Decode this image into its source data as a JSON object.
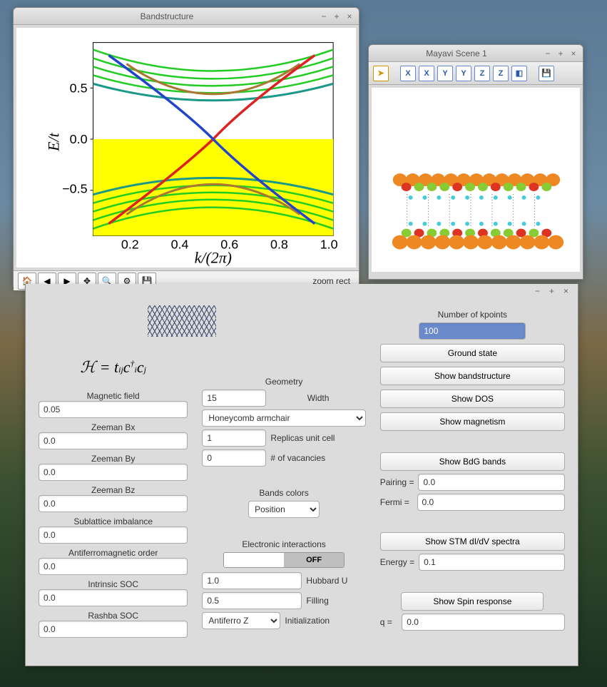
{
  "bandstructure_window": {
    "title": "Bandstructure",
    "ylabel": "E/t",
    "xlabel": "k/(2π)",
    "status": "zoom rect",
    "yticks": [
      "0.5",
      "0.0",
      "−0.5"
    ],
    "xticks": [
      "0.2",
      "0.4",
      "0.6",
      "0.8",
      "1.0"
    ]
  },
  "mayavi_window": {
    "title": "Mayavi Scene 1",
    "axis_buttons": [
      "X",
      "X",
      "Y",
      "Y",
      "Z",
      "Z"
    ]
  },
  "controls": {
    "hamiltonian": "ℋ = t𝑖𝑗 c†𝑖 c𝑗",
    "col1": {
      "magnetic_field_label": "Magnetic field",
      "magnetic_field": "0.05",
      "zeeman_bx_label": "Zeeman Bx",
      "zeeman_bx": "0.0",
      "zeeman_by_label": "Zeeman By",
      "zeeman_by": "0.0",
      "zeeman_bz_label": "Zeeman Bz",
      "zeeman_bz": "0.0",
      "sublattice_label": "Sublattice imbalance",
      "sublattice": "0.0",
      "afm_label": "Antiferromagnetic order",
      "afm": "0.0",
      "intrinsic_soc_label": "Intrinsic SOC",
      "intrinsic_soc": "0.0",
      "rashba_soc_label": "Rashba SOC",
      "rashba_soc": "0.0"
    },
    "col2": {
      "geometry_label": "Geometry",
      "width": "15",
      "width_label": "Width",
      "lattice": "Honeycomb armchair",
      "replicas": "1",
      "replicas_label": "Replicas unit cell",
      "vacancies": "0",
      "vacancies_label": "# of vacancies",
      "bands_colors_label": "Bands colors",
      "bands_colors": "Position",
      "eint_label": "Electronic interactions",
      "eint_toggle": "OFF",
      "hubbard": "1.0",
      "hubbard_label": "Hubbard U",
      "filling": "0.5",
      "filling_label": "Filling",
      "init": "Antiferro Z",
      "init_label": "Initialization"
    },
    "col3": {
      "kpoints_label": "Number of kpoints",
      "kpoints": "100",
      "ground_state": "Ground state",
      "show_bands": "Show bandstructure",
      "show_dos": "Show DOS",
      "show_mag": "Show magnetism",
      "show_bdg": "Show BdG bands",
      "pairing_label": "Pairing =",
      "pairing": "0.0",
      "fermi_label": "Fermi =",
      "fermi": "0.0",
      "show_stm": "Show STM dI/dV spectra",
      "energy_label": "Energy =",
      "energy": "0.1",
      "show_spin": "Show Spin response",
      "q_label": "q =",
      "q": "0.0"
    }
  },
  "chart_data": {
    "type": "line",
    "title": "Bandstructure",
    "xlabel": "k/(2π)",
    "ylabel": "E/t",
    "xlim": [
      0.05,
      1.0
    ],
    "ylim": [
      -0.9,
      0.9
    ],
    "description": "Multi-band electronic band structure of a honeycomb armchair ribbon. Dense green bulk bands occupy |E/t|>0.45; yellow shaded region marks occupied states E/t<0. Two in-gap edge/surface bands dispersing roughly linearly through the gap, colored red (left-origin) and blue (right-origin), cross near k≈0.5, E≈0.",
    "series": [
      {
        "name": "edge-band-red",
        "color": "#dd2222",
        "x": [
          0.05,
          0.15,
          0.25,
          0.35,
          0.45,
          0.5,
          0.55,
          0.65,
          0.75,
          0.85,
          0.95
        ],
        "y": [
          -0.8,
          -0.72,
          -0.55,
          -0.3,
          -0.08,
          0.0,
          0.1,
          0.35,
          0.55,
          0.7,
          0.78
        ]
      },
      {
        "name": "edge-band-blue",
        "color": "#2244cc",
        "x": [
          0.05,
          0.15,
          0.25,
          0.35,
          0.45,
          0.5,
          0.55,
          0.65,
          0.75,
          0.85,
          0.95
        ],
        "y": [
          0.78,
          0.7,
          0.55,
          0.35,
          0.1,
          0.0,
          -0.08,
          -0.3,
          -0.55,
          -0.72,
          -0.8
        ]
      },
      {
        "name": "bulk-conduction-envelope",
        "color": "#22cc22",
        "x": [
          0.05,
          0.25,
          0.5,
          0.75,
          0.95
        ],
        "y": [
          0.82,
          0.62,
          0.45,
          0.62,
          0.82
        ]
      },
      {
        "name": "bulk-valence-envelope",
        "color": "#22cc22",
        "x": [
          0.05,
          0.25,
          0.5,
          0.75,
          0.95
        ],
        "y": [
          -0.82,
          -0.62,
          -0.45,
          -0.62,
          -0.82
        ]
      }
    ],
    "shaded_region": {
      "ymin": -0.9,
      "ymax": 0.0,
      "color": "#ffff00"
    }
  }
}
